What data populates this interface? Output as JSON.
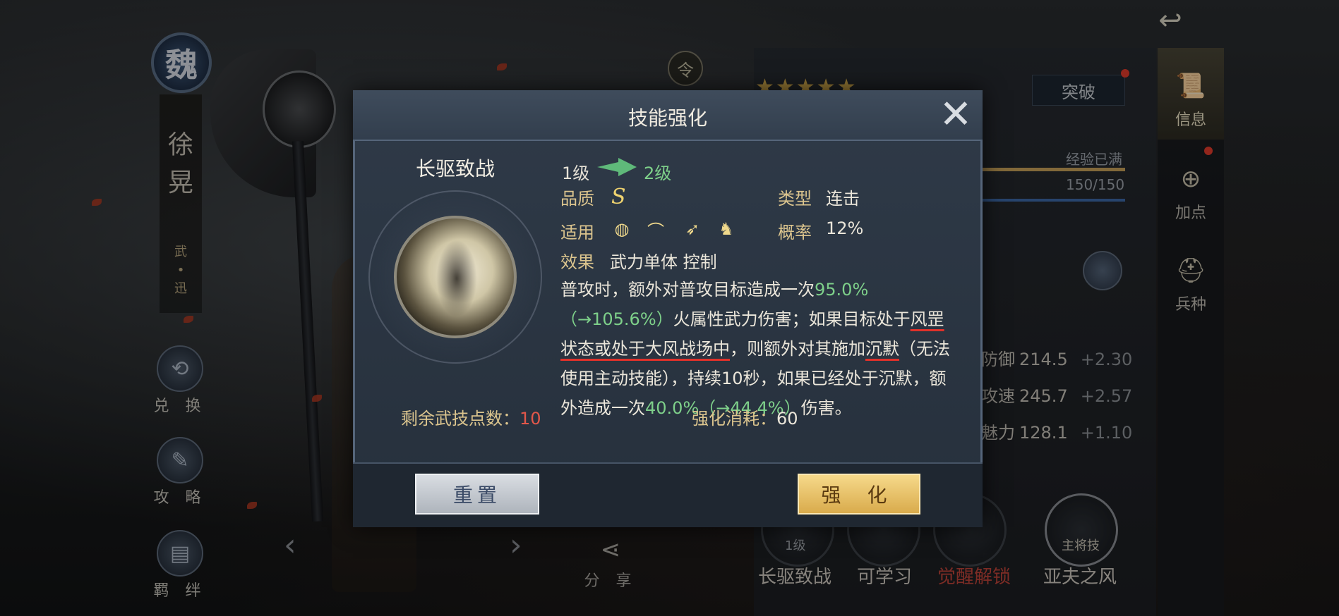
{
  "hero": {
    "faction": "魏",
    "name_chars": [
      "徐",
      "晃"
    ],
    "tag_chars": [
      "武",
      "•",
      "迅"
    ]
  },
  "left_menu": [
    {
      "label": "兑 换",
      "icon": "exchange-icon"
    },
    {
      "label": "攻 略",
      "icon": "scroll-icon"
    },
    {
      "label": "羁 绊",
      "icon": "bond-icon"
    }
  ],
  "top_badge": "令",
  "share": {
    "label": "分 享",
    "icon": "share-icon"
  },
  "nav": {
    "prev": "‹",
    "next": "›"
  },
  "right_panel": {
    "stars": "★★★★★",
    "breakthrough_label": "突破",
    "exp_label": "经验已满",
    "exp_value": "150/150",
    "stats": [
      {
        "name": "防御",
        "value": "214.5",
        "delta": "+2.30"
      },
      {
        "name": "攻速",
        "value": "245.7",
        "delta": "+2.57"
      },
      {
        "name": "魅力",
        "value": "128.1",
        "delta": "+1.10"
      }
    ],
    "skills": [
      {
        "name": "长驱致战",
        "badge": "1级"
      },
      {
        "name": "可学习",
        "badge": ""
      },
      {
        "name": "觉醒解锁",
        "badge": ""
      },
      {
        "name": "亚夫之风",
        "badge": "主将技"
      }
    ],
    "tabs": [
      {
        "label": "信息",
        "icon": "scroll-icon"
      },
      {
        "label": "加点",
        "icon": "add-points-icon"
      },
      {
        "label": "兵种",
        "icon": "helmet-icon"
      }
    ]
  },
  "dialog": {
    "title": "技能强化",
    "skill_name": "长驱致战",
    "level_from": "1级",
    "level_to": "2级",
    "quality_label": "品质",
    "quality_value": "S",
    "type_label": "类型",
    "type_value": "连击",
    "apply_label": "适用",
    "apply_icons": [
      "shield-icon",
      "bow-icon",
      "spear-icon",
      "horse-icon"
    ],
    "chance_label": "概率",
    "chance_value": "12%",
    "effect_label": "效果",
    "effect_value": "武力单体 控制",
    "desc": {
      "p1": "普攻时，额外对普攻目标造成一次",
      "g1": "95.0%",
      "g2": "（→105.6%）",
      "p2": "火属性武力伤害；如果目标处于",
      "u1": "风罡状态或处于大风战场中",
      "p3": "，则额外对其施加",
      "u2": "沉默",
      "p4": "（无法使用主动技能），持续10秒，如果已经处于沉默，额外造成一次",
      "g3": "40.0%",
      "g4": "（→44.4%）",
      "p5": "伤害。"
    },
    "points_label": "剩余武技点数：",
    "points_value": "10",
    "cost_label": "强化消耗：",
    "cost_value": "60",
    "reset_label": "重置",
    "upgrade_label": "强 化"
  }
}
